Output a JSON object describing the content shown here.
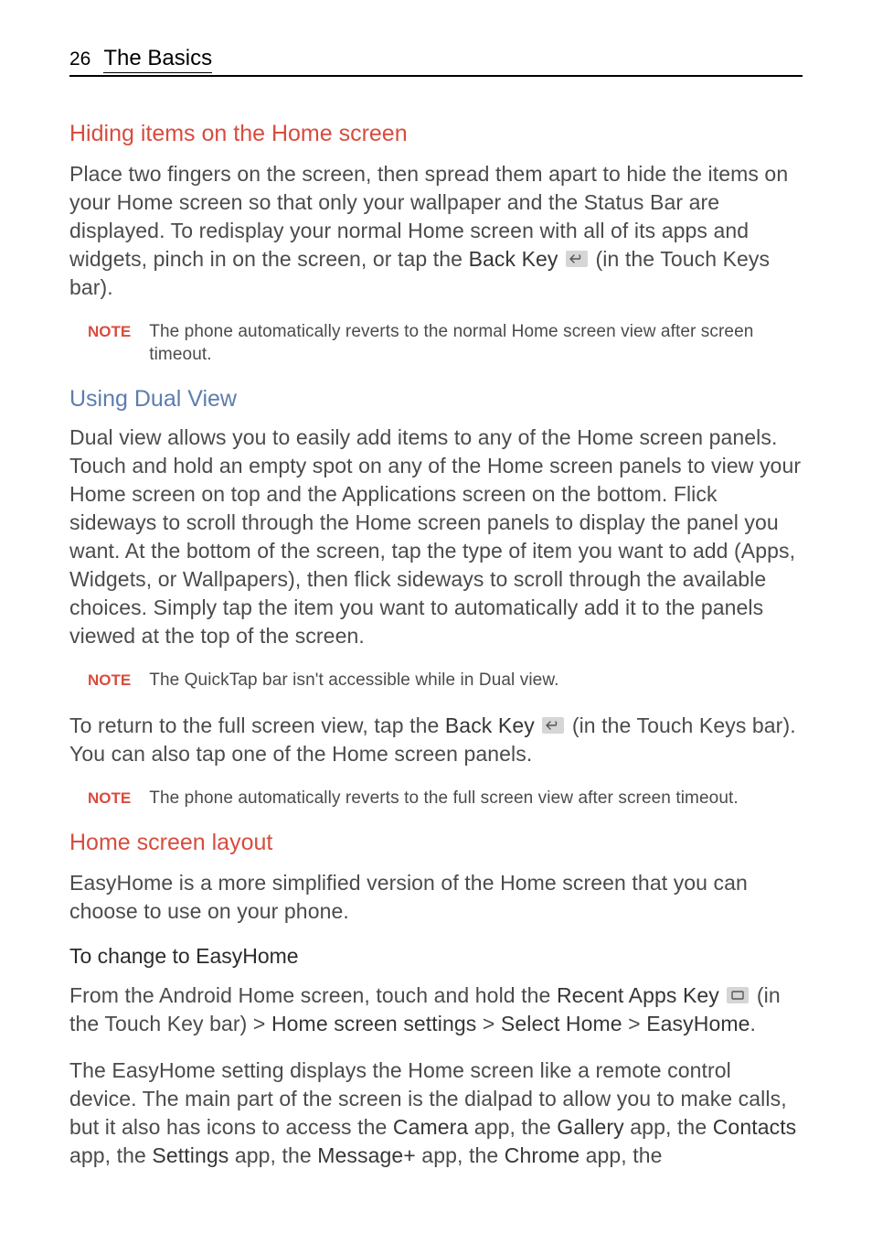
{
  "header": {
    "page_number": "26",
    "title": "The Basics"
  },
  "sections": {
    "hiding": {
      "heading": "Hiding items on the Home screen",
      "body_a": "Place two fingers on the screen, then spread them apart to hide the items on your Home screen so that only your wallpaper and the Status Bar are displayed. To redisplay your normal Home screen with all of its apps and widgets, pinch in on the screen, or tap the ",
      "back_key": "Back Key",
      "body_b": " (in the Touch Keys bar).",
      "note_label": "NOTE",
      "note_text": "The phone automatically reverts to the normal Home screen view after screen timeout."
    },
    "dual": {
      "heading": "Using Dual View",
      "body1": "Dual view allows you to easily add items to any of the Home screen panels. Touch and hold an empty spot on any of the Home screen panels to view your Home screen on top and the Applications screen on the bottom. Flick sideways to scroll through the Home screen panels to display the panel you want. At the bottom of the screen, tap the type of item you want to add (Apps, Widgets, or Wallpapers), then flick sideways to scroll through the available choices. Simply tap the item you want to automatically add it to the panels viewed at the top of the screen.",
      "note1_label": "NOTE",
      "note1_text": "The QuickTap bar isn't accessible while in Dual view.",
      "body2_a": "To return to the full screen view, tap the ",
      "back_key": "Back Key",
      "body2_b": " (in the Touch Keys bar). You can also tap one of the Home screen panels.",
      "note2_label": "NOTE",
      "note2_text": "The phone automatically reverts to the full screen view after screen timeout."
    },
    "layout": {
      "heading": "Home screen layout",
      "body1": "EasyHome is a more simplified version of the Home screen that you can choose to use on your phone.",
      "sub_heading": "To change to EasyHome",
      "body2_a": "From the Android Home screen, touch and hold the ",
      "recent_key": "Recent Apps Key",
      "body2_b": " (in the Touch Key bar) > ",
      "home_settings": "Home screen settings",
      "gt1": " > ",
      "select_home": "Select Home",
      "gt2": " > ",
      "easyhome": "EasyHome",
      "period": ".",
      "body3_a": "The EasyHome setting displays the Home screen like a remote control device. The main part of the screen is the dialpad to allow you to make calls, but it also has icons to access the ",
      "camera": "Camera",
      "body3_b": " app, the ",
      "gallery": "Gallery",
      "body3_c": " app, the ",
      "contacts": "Contacts",
      "body3_d": " app, the ",
      "settings": "Settings",
      "body3_e": " app, the ",
      "messageplus": "Message+",
      "body3_f": " app, the ",
      "chrome": "Chrome",
      "body3_g": " app, the"
    }
  }
}
